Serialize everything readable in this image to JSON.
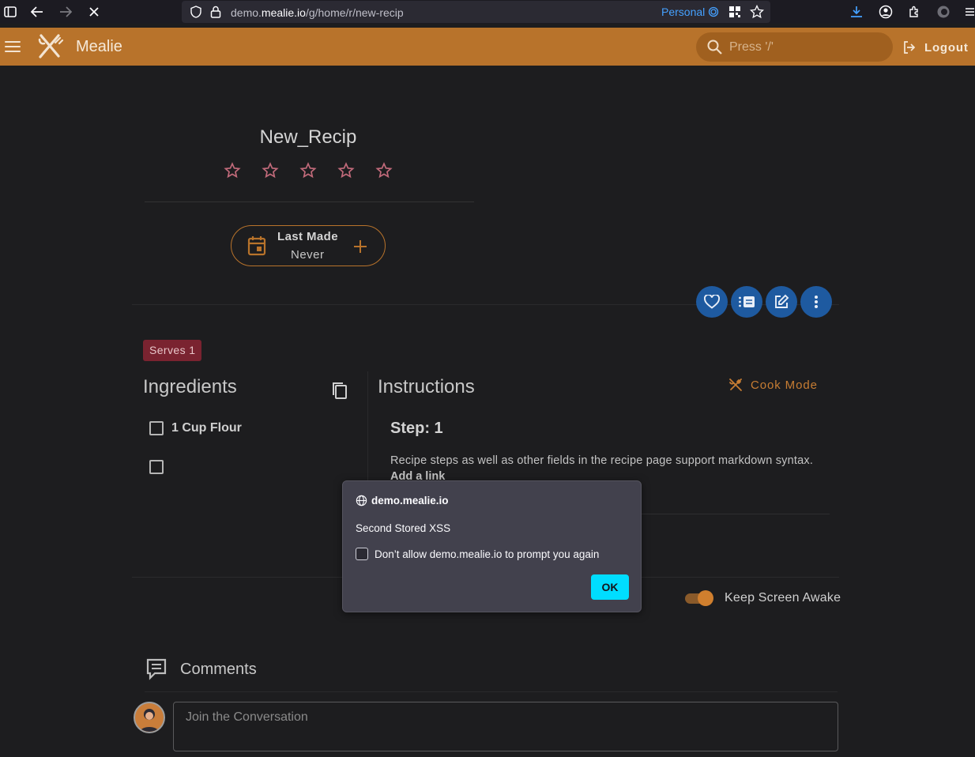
{
  "browser": {
    "url_prefix": "demo.",
    "url_domain": "mealie.io",
    "url_path": "/g/home/r/new-recip",
    "profile_label": "Personal"
  },
  "appbar": {
    "title": "Mealie",
    "search_placeholder": "Press '/'",
    "logout_label": "Logout",
    "accent_color": "#b8732b"
  },
  "recipe": {
    "title": "New_Recip",
    "rating_stars": 5,
    "rating_value": 0,
    "last_made_label": "Last Made",
    "last_made_value": "Never",
    "serves_label": "Serves 1"
  },
  "ingredients": {
    "heading": "Ingredients",
    "items": [
      {
        "text": "1 Cup Flour"
      },
      {
        "text": ""
      }
    ]
  },
  "instructions": {
    "heading": "Instructions",
    "cook_mode_label": "Cook Mode",
    "steps": [
      {
        "title": "Step: 1",
        "text": "Recipe steps as well as other fields in the recipe page support markdown syntax.",
        "link_text": "Add a link"
      }
    ]
  },
  "keep_awake": {
    "label": "Keep Screen Awake",
    "enabled": true
  },
  "comments": {
    "heading": "Comments",
    "placeholder": "Join the Conversation"
  },
  "dialog": {
    "origin": "demo.mealie.io",
    "message": "Second Stored XSS",
    "checkbox_label": "Don’t allow demo.mealie.io to prompt you again",
    "ok_label": "OK"
  },
  "icons": {
    "fab_buttons": [
      "heart-icon",
      "list-icon",
      "edit-icon",
      "more-vertical-icon"
    ]
  }
}
